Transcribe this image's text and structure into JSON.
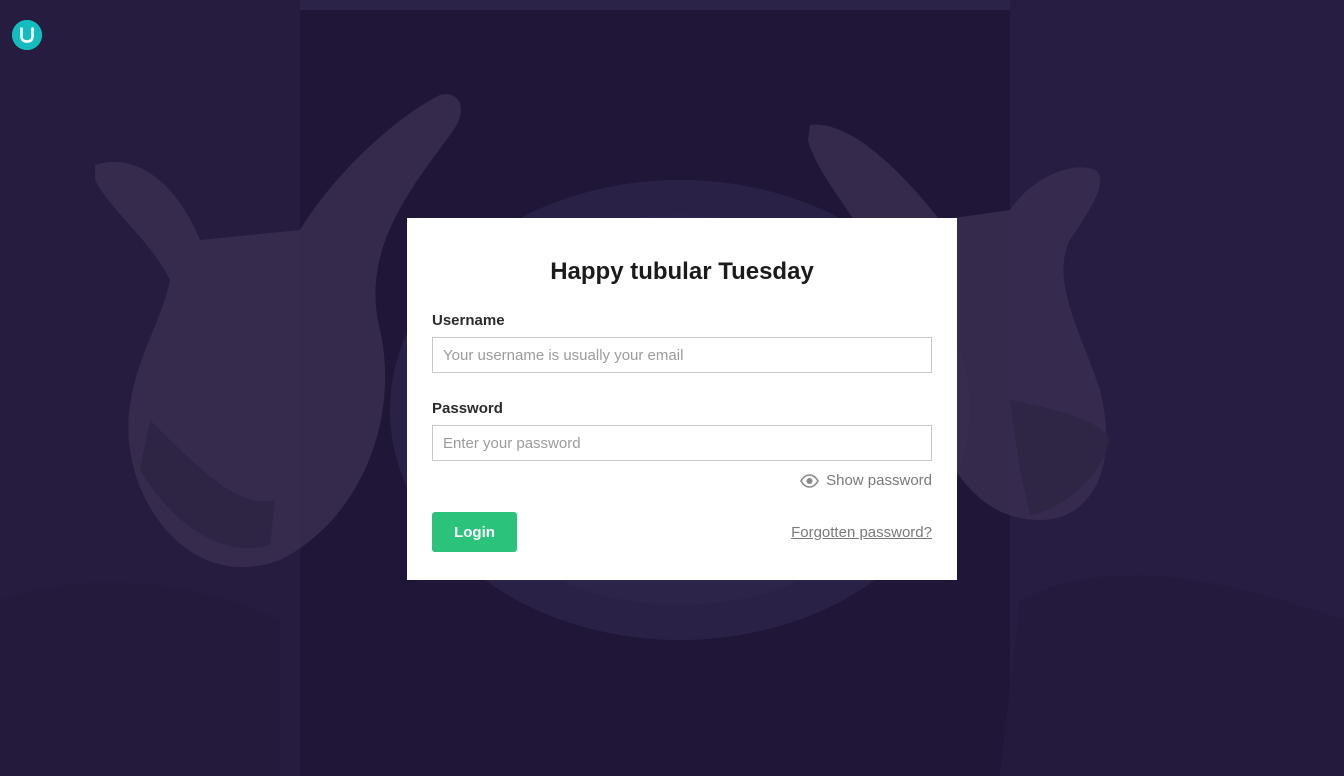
{
  "app": {
    "logo_icon": "umbraco-logo-icon",
    "brand_color": "#15bcbf",
    "background_color": "#201738"
  },
  "login": {
    "title": "Happy tubular Tuesday",
    "username_label": "Username",
    "username_placeholder": "Your username is usually your email",
    "username_value": "",
    "password_label": "Password",
    "password_placeholder": "Enter your password",
    "password_value": "",
    "show_password_icon": "eye-icon",
    "show_password_label": "Show password",
    "login_button_label": "Login",
    "login_button_color": "#2bc37c",
    "forgot_password_label": "Forgotten password?"
  }
}
